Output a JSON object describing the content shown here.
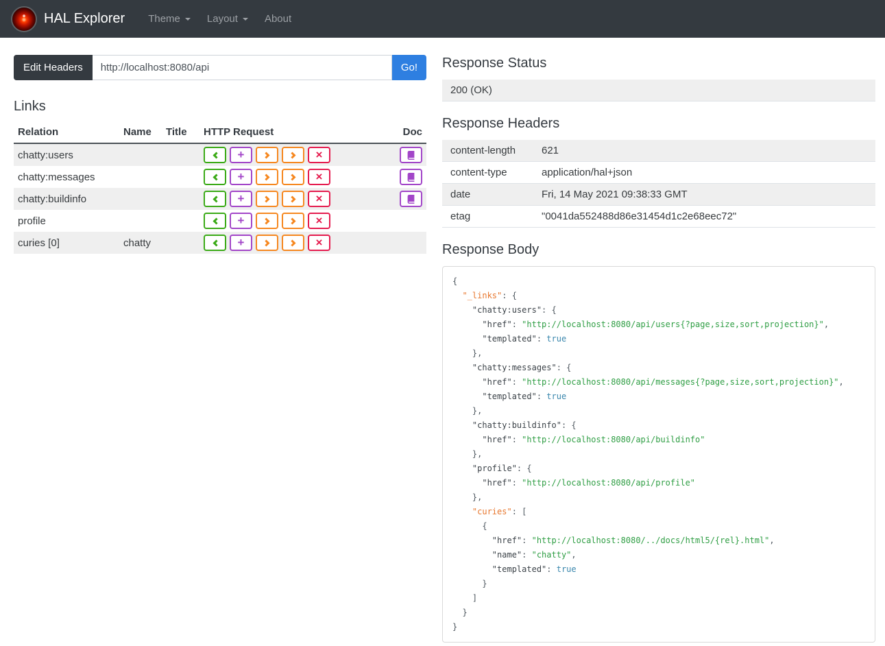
{
  "navbar": {
    "brand": "HAL Explorer",
    "items": [
      {
        "id": "theme",
        "label": "Theme",
        "caret": true
      },
      {
        "id": "layout",
        "label": "Layout",
        "caret": true
      },
      {
        "id": "about",
        "label": "About",
        "caret": false
      }
    ]
  },
  "toolbar": {
    "edit_headers_label": "Edit Headers",
    "url_value": "http://localhost:8080/api",
    "go_label": "Go!"
  },
  "links": {
    "heading": "Links",
    "columns": [
      "Relation",
      "Name",
      "Title",
      "HTTP Request",
      "Doc"
    ],
    "http_buttons": [
      {
        "method": "get",
        "icon": "chevron-left-icon",
        "color": "#3aaa16"
      },
      {
        "method": "post",
        "icon": "plus-icon",
        "glyph": "+",
        "color": "#a245c8"
      },
      {
        "method": "put",
        "icon": "chevron-right-icon",
        "color": "#f6871f"
      },
      {
        "method": "patch",
        "icon": "chevron-right-icon",
        "color": "#f6871f"
      },
      {
        "method": "delete",
        "icon": "x-icon",
        "glyph": "×",
        "color": "#e51b4e"
      }
    ],
    "rows": [
      {
        "relation": "chatty:users",
        "name": "",
        "title": "",
        "doc": true
      },
      {
        "relation": "chatty:messages",
        "name": "",
        "title": "",
        "doc": true
      },
      {
        "relation": "chatty:buildinfo",
        "name": "",
        "title": "",
        "doc": true
      },
      {
        "relation": "profile",
        "name": "",
        "title": "",
        "doc": false
      },
      {
        "relation": "curies [0]",
        "name": "chatty",
        "title": "",
        "doc": false
      }
    ]
  },
  "response": {
    "status_heading": "Response Status",
    "status": "200 (OK)",
    "headers_heading": "Response Headers",
    "headers": [
      {
        "key": "content-length",
        "value": "621"
      },
      {
        "key": "content-type",
        "value": "application/hal+json"
      },
      {
        "key": "date",
        "value": "Fri, 14 May 2021 09:38:33 GMT"
      },
      {
        "key": "etag",
        "value": "\"0041da552488d86e31454d1c2e68eec72\""
      }
    ],
    "body_heading": "Response Body",
    "body_lines": [
      [
        {
          "c": "p",
          "t": "{"
        }
      ],
      [
        {
          "c": "ko",
          "t": "  \"_links\""
        },
        {
          "c": "p",
          "t": ": {"
        }
      ],
      [
        {
          "c": "k",
          "t": "    \"chatty:users\""
        },
        {
          "c": "p",
          "t": ": {"
        }
      ],
      [
        {
          "c": "k",
          "t": "      \"href\""
        },
        {
          "c": "p",
          "t": ": "
        },
        {
          "c": "s",
          "t": "\"http://localhost:8080/api/users{?page,size,sort,projection}\""
        },
        {
          "c": "p",
          "t": ","
        }
      ],
      [
        {
          "c": "k",
          "t": "      \"templated\""
        },
        {
          "c": "p",
          "t": ": "
        },
        {
          "c": "b",
          "t": "true"
        }
      ],
      [
        {
          "c": "p",
          "t": "    },"
        }
      ],
      [
        {
          "c": "k",
          "t": "    \"chatty:messages\""
        },
        {
          "c": "p",
          "t": ": {"
        }
      ],
      [
        {
          "c": "k",
          "t": "      \"href\""
        },
        {
          "c": "p",
          "t": ": "
        },
        {
          "c": "s",
          "t": "\"http://localhost:8080/api/messages{?page,size,sort,projection}\""
        },
        {
          "c": "p",
          "t": ","
        }
      ],
      [
        {
          "c": "k",
          "t": "      \"templated\""
        },
        {
          "c": "p",
          "t": ": "
        },
        {
          "c": "b",
          "t": "true"
        }
      ],
      [
        {
          "c": "p",
          "t": "    },"
        }
      ],
      [
        {
          "c": "k",
          "t": "    \"chatty:buildinfo\""
        },
        {
          "c": "p",
          "t": ": {"
        }
      ],
      [
        {
          "c": "k",
          "t": "      \"href\""
        },
        {
          "c": "p",
          "t": ": "
        },
        {
          "c": "s",
          "t": "\"http://localhost:8080/api/buildinfo\""
        }
      ],
      [
        {
          "c": "p",
          "t": "    },"
        }
      ],
      [
        {
          "c": "k",
          "t": "    \"profile\""
        },
        {
          "c": "p",
          "t": ": {"
        }
      ],
      [
        {
          "c": "k",
          "t": "      \"href\""
        },
        {
          "c": "p",
          "t": ": "
        },
        {
          "c": "s",
          "t": "\"http://localhost:8080/api/profile\""
        }
      ],
      [
        {
          "c": "p",
          "t": "    },"
        }
      ],
      [
        {
          "c": "ko",
          "t": "    \"curies\""
        },
        {
          "c": "p",
          "t": ": ["
        }
      ],
      [
        {
          "c": "p",
          "t": "      {"
        }
      ],
      [
        {
          "c": "k",
          "t": "        \"href\""
        },
        {
          "c": "p",
          "t": ": "
        },
        {
          "c": "s",
          "t": "\"http://localhost:8080/../docs/html5/{rel}.html\""
        },
        {
          "c": "p",
          "t": ","
        }
      ],
      [
        {
          "c": "k",
          "t": "        \"name\""
        },
        {
          "c": "p",
          "t": ": "
        },
        {
          "c": "s",
          "t": "\"chatty\""
        },
        {
          "c": "p",
          "t": ","
        }
      ],
      [
        {
          "c": "k",
          "t": "        \"templated\""
        },
        {
          "c": "p",
          "t": ": "
        },
        {
          "c": "b",
          "t": "true"
        }
      ],
      [
        {
          "c": "p",
          "t": "      }"
        }
      ],
      [
        {
          "c": "p",
          "t": "    ]"
        }
      ],
      [
        {
          "c": "p",
          "t": "  }"
        }
      ],
      [
        {
          "c": "p",
          "t": "}"
        }
      ]
    ]
  },
  "colors": {
    "navbar_bg": "#343a40",
    "accent_blue": "#2e7fe1",
    "stripe": "#efefef",
    "json_key": "#3b4248",
    "json_special_key": "#e8772e",
    "json_string": "#2f9e44",
    "json_literal": "#3a87ad",
    "json_punct": "#4d565e"
  }
}
